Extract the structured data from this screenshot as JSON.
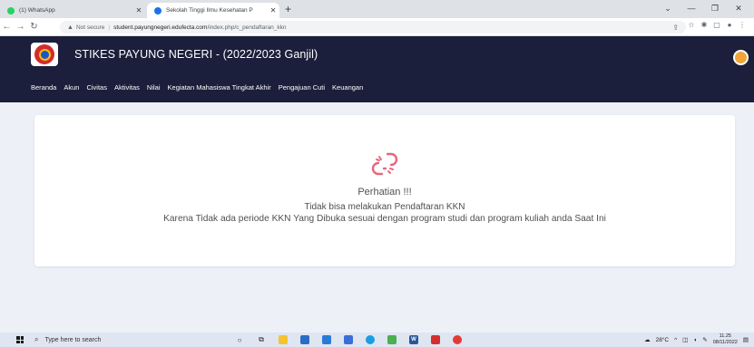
{
  "browser": {
    "tabs": [
      {
        "title": "(1) WhatsApp",
        "favicon_color": "#25d366"
      },
      {
        "title": "Sekolah Tinggi Ilmu Kesehatan P",
        "favicon_color": "#1a73e8"
      }
    ],
    "new_tab": "+",
    "address": {
      "security": "Not secure",
      "host": "student.payungnegeri.edufecta.com",
      "path": "/index.php/c_pendaftaran_kkn"
    }
  },
  "site": {
    "title": "STIKES PAYUNG NEGERI - (2022/2023 Ganjil)",
    "menu": [
      "Beranda",
      "Akun",
      "Civitas",
      "Aktivitas",
      "Nilai",
      "Kegiatan Mahasiswa Tingkat Akhir",
      "Pengajuan Cuti",
      "Keuangan"
    ]
  },
  "notice": {
    "icon": "broken-link-icon",
    "icon_color": "#e8677a",
    "title": "Perhatian !!!",
    "line1": "Tidak bisa melakukan Pendaftaran KKN",
    "line2": "Karena Tidak ada periode KKN Yang Dibuka sesuai dengan program studi dan program kuliah anda Saat Ini"
  },
  "taskbar": {
    "search_placeholder": "Type here to search",
    "weather": "28°C",
    "time": "11.25",
    "date": "08/11/2022"
  },
  "colors": {
    "header_bg": "#1b1f3b",
    "content_bg": "#eef0f8"
  }
}
